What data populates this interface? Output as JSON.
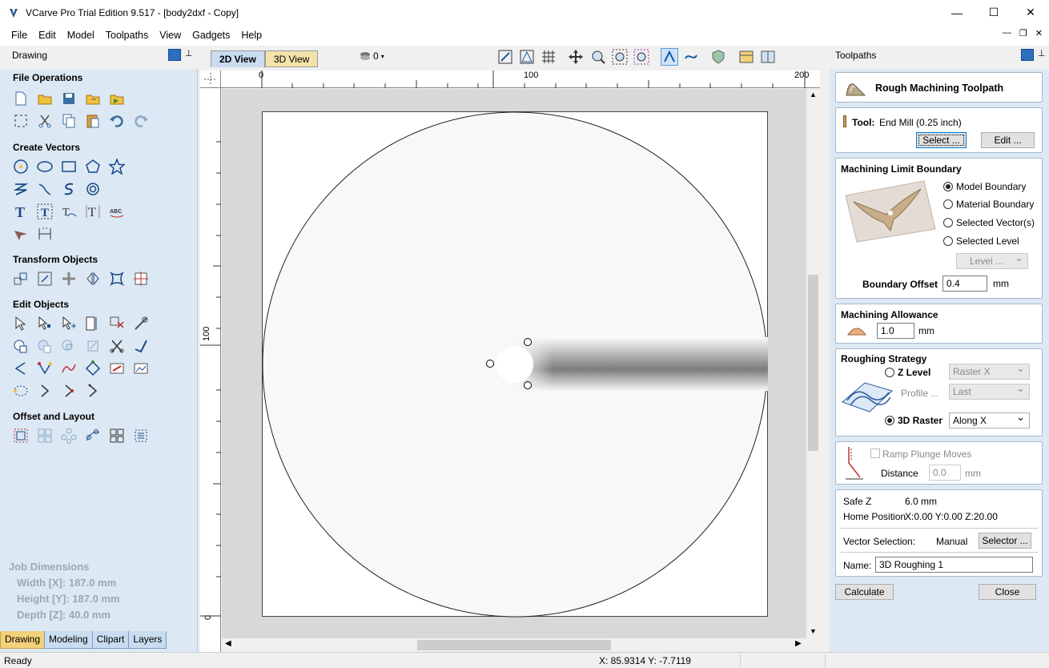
{
  "window": {
    "title": "VCarve Pro Trial Edition 9.517 - [body2dxf - Copy]",
    "minimize": "—",
    "maximize": "☐",
    "close": "✕"
  },
  "menu": [
    "File",
    "Edit",
    "Model",
    "Toolpaths",
    "View",
    "Gadgets",
    "Help"
  ],
  "toolbar": {
    "layer_count": "0"
  },
  "view_tabs": [
    "2D View",
    "3D View"
  ],
  "left_panel": {
    "title": "Drawing",
    "sections": {
      "file_operations": "File Operations",
      "create_vectors": "Create Vectors",
      "transform_objects": "Transform Objects",
      "edit_objects": "Edit Objects",
      "offset_and_layout": "Offset and Layout"
    },
    "job_dimensions": {
      "title": "Job Dimensions",
      "width": "Width  [X]: 187.0 mm",
      "height": "Height [Y]: 187.0 mm",
      "depth": "Depth  [Z]: 40.0 mm"
    },
    "tabs": [
      "Drawing",
      "Modeling",
      "Clipart",
      "Layers"
    ]
  },
  "rulers": {
    "top": [
      "0",
      "100",
      "200"
    ],
    "left": [
      "100",
      "0"
    ]
  },
  "right_panel": {
    "title": "Toolpaths",
    "header": "Rough Machining Toolpath",
    "tool": {
      "label": "Tool:",
      "value": "End Mill (0.25 inch)",
      "select": "Select ...",
      "edit": "Edit ..."
    },
    "boundary": {
      "title": "Machining Limit Boundary",
      "options": [
        "Model Boundary",
        "Material Boundary",
        "Selected Vector(s)",
        "Selected Level"
      ],
      "level_placeholder": "Level ...",
      "offset_label": "Boundary Offset",
      "offset_value": "0.4",
      "unit": "mm"
    },
    "allowance": {
      "title": "Machining Allowance",
      "value": "1.0",
      "unit": "mm"
    },
    "strategy": {
      "title": "Roughing Strategy",
      "z_level": "Z Level",
      "z_level_select": "Raster X",
      "profile_label": "Profile ...",
      "profile_select": "Last",
      "raster_3d": "3D Raster",
      "raster_select": "Along X"
    },
    "ramp": {
      "label": "Ramp Plunge Moves",
      "distance_label": "Distance",
      "distance_value": "0.0",
      "unit": "mm"
    },
    "settings": {
      "safe_z_label": "Safe Z",
      "safe_z_value": "6.0 mm",
      "home_label": "Home Position",
      "home_value": "X:0.00 Y:0.00 Z:20.00",
      "vector_label": "Vector Selection:",
      "vector_value": "Manual",
      "selector": "Selector ...",
      "name_label": "Name:",
      "name_value": "3D Roughing 1"
    },
    "calculate": "Calculate",
    "close": "Close"
  },
  "status": {
    "left": "Ready",
    "coords": "X: 85.9314 Y: -7.7119"
  }
}
